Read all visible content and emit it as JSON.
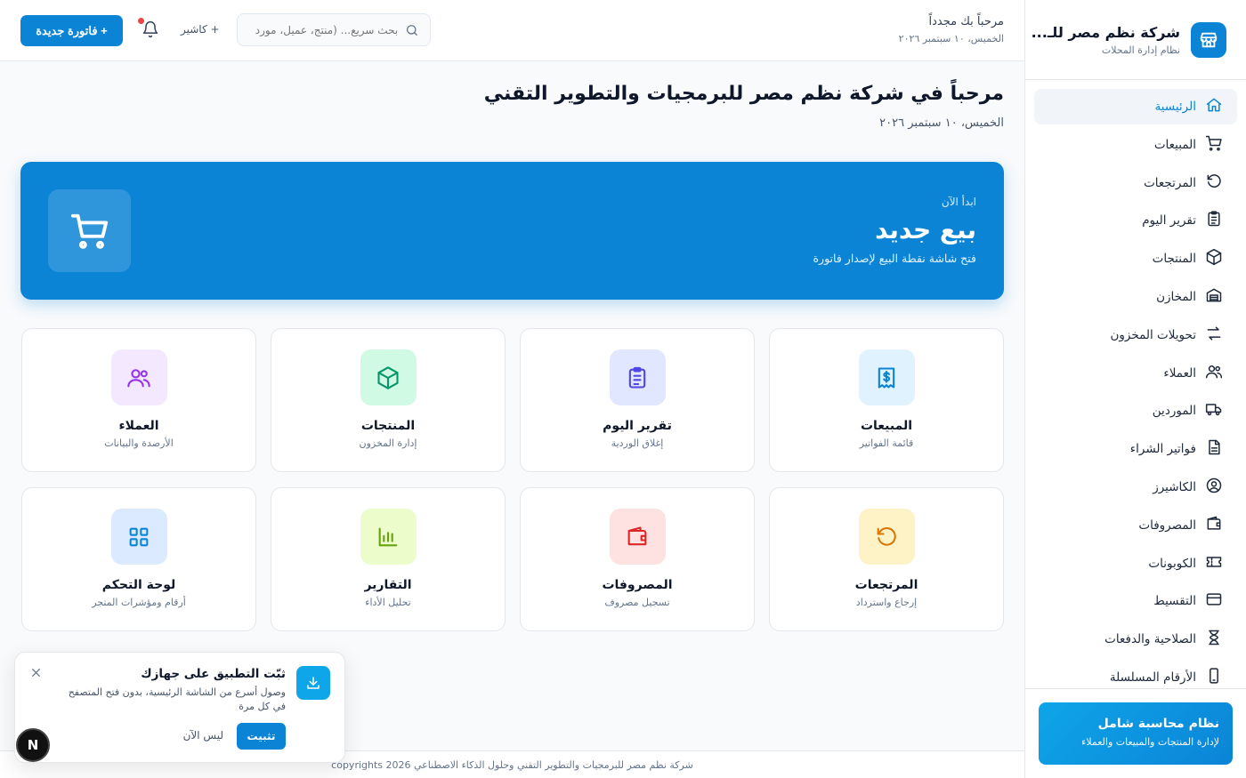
{
  "sidebar": {
    "brand_name": "شركة نظم مصر للـ...",
    "brand_sub": "نظام إدارة المحلات",
    "items": [
      {
        "label": "الرئيسية",
        "icon": "home-icon"
      },
      {
        "label": "المبيعات",
        "icon": "cart-icon"
      },
      {
        "label": "المرتجعات",
        "icon": "undo-icon"
      },
      {
        "label": "تقرير اليوم",
        "icon": "clipboard-icon"
      },
      {
        "label": "المنتجات",
        "icon": "box-icon"
      },
      {
        "label": "المخازن",
        "icon": "warehouse-icon"
      },
      {
        "label": "تحويلات المخزون",
        "icon": "transfer-icon"
      },
      {
        "label": "العملاء",
        "icon": "users-icon"
      },
      {
        "label": "الموردين",
        "icon": "truck-icon"
      },
      {
        "label": "فواتير الشراء",
        "icon": "file-icon"
      },
      {
        "label": "الكاشيرز",
        "icon": "user-circle-icon"
      },
      {
        "label": "المصروفات",
        "icon": "wallet-icon"
      },
      {
        "label": "الكوبونات",
        "icon": "ticket-icon"
      },
      {
        "label": "التقسيط",
        "icon": "card-icon"
      },
      {
        "label": "الصلاحية والدفعات",
        "icon": "hourglass-icon"
      },
      {
        "label": "الأرقام المسلسلة",
        "icon": "phone-icon"
      }
    ],
    "promo_title": "نظام محاسبة شامل",
    "promo_sub": "لإدارة المنتجات والمبيعات والعملاء"
  },
  "header": {
    "welcome": "مرحباً بك مجدداً",
    "date": "الخميس، ١٠ سبتمبر ٢٠٢٦",
    "search_placeholder": "بحث سريع... (منتج، عميل، مورد",
    "cashier_label": "+ كاشير",
    "new_invoice_label": "+ فاتورة جديدة"
  },
  "main": {
    "title": "مرحباً في شركة نظم مصر للبرمجيات والتطوير التقني",
    "date": "الخميس، ١٠ سبتمبر ٢٠٢٦",
    "hero": {
      "kicker": "ابدأ الآن",
      "title": "بيع جديد",
      "subtitle": "فتح شاشة نقطة البيع لإصدار فاتورة"
    },
    "cards": [
      {
        "title": "المبيعات",
        "sub": "قائمة الفواتير",
        "icon": "receipt-icon",
        "color": "#0b84d6",
        "bg": "#e0f2fe"
      },
      {
        "title": "تقرير اليوم",
        "sub": "إغلاق الوردية",
        "icon": "clipboard-icon",
        "color": "#4f46e5",
        "bg": "#e0e7ff"
      },
      {
        "title": "المنتجات",
        "sub": "إدارة المخزون",
        "icon": "box-icon",
        "color": "#059669",
        "bg": "#d1fae5"
      },
      {
        "title": "العملاء",
        "sub": "الأرصدة والبيانات",
        "icon": "users-icon",
        "color": "#9333ea",
        "bg": "#f3e8ff"
      },
      {
        "title": "المرتجعات",
        "sub": "إرجاع واسترداد",
        "icon": "undo-icon",
        "color": "#d97706",
        "bg": "#fef3c7"
      },
      {
        "title": "المصروفات",
        "sub": "تسجيل مصروف",
        "icon": "wallet-icon",
        "color": "#dc2626",
        "bg": "#fee2e2"
      },
      {
        "title": "التقارير",
        "sub": "تحليل الأداء",
        "icon": "bar-chart-icon",
        "color": "#65a30d",
        "bg": "#ecfccb"
      },
      {
        "title": "لوحة التحكم",
        "sub": "أرقام ومؤشرات المتجر",
        "icon": "grid-icon",
        "color": "#0b84d6",
        "bg": "#dbeafe"
      }
    ]
  },
  "install_prompt": {
    "title": "ثبّت التطبيق على جهازك",
    "desc": "وصول أسرع من الشاشة الرئيسية، بدون فتح المتصفح في كل مرة",
    "install_label": "تثبيت",
    "later_label": "ليس الآن"
  },
  "footer": {
    "text": "شركة نظم مصر للبرمجيات والتطوير التقني وحلول الذكاء الاصطناعي copyrights 2026"
  },
  "badge_letter": "N"
}
